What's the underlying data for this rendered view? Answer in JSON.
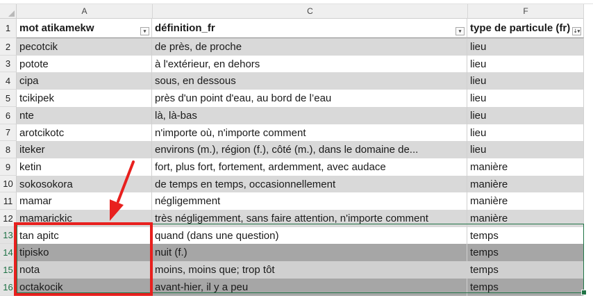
{
  "columns": [
    "A",
    "C",
    "F"
  ],
  "headers": {
    "A": "mot atikamekw",
    "C": "définition_fr",
    "F": "type de particule (fr)"
  },
  "rows": [
    {
      "n": "2",
      "a": "pecotcik",
      "c": "de près, de proche",
      "f": "lieu"
    },
    {
      "n": "3",
      "a": "potote",
      "c": "à l'extérieur, en dehors",
      "f": "lieu"
    },
    {
      "n": "4",
      "a": "cipa",
      "c": "sous, en dessous",
      "f": "lieu"
    },
    {
      "n": "5",
      "a": "tcikipek",
      "c": "près d'un point d'eau, au bord de l’eau",
      "f": "lieu"
    },
    {
      "n": "6",
      "a": "nte",
      "c": "là, là-bas",
      "f": "lieu"
    },
    {
      "n": "7",
      "a": "arotcikotc",
      "c": "n'importe où, n'importe comment",
      "f": "lieu"
    },
    {
      "n": "8",
      "a": "iteker",
      "c": "environs (m.), région (f.), côté (m.), dans le domaine de...",
      "f": "lieu"
    },
    {
      "n": "9",
      "a": "ketin",
      "c": "fort, plus fort, fortement, ardemment, avec audace",
      "f": "manière"
    },
    {
      "n": "10",
      "a": "sokosokora",
      "c": "de temps en temps, occasionnellement",
      "f": "manière"
    },
    {
      "n": "11",
      "a": "mamar",
      "c": "négligemment",
      "f": "manière"
    },
    {
      "n": "12",
      "a": "mamarickic",
      "c": "très négligemment, sans faire attention, n'importe comment",
      "f": "manière"
    },
    {
      "n": "13",
      "a": "tan apitc",
      "c": "quand (dans une question)",
      "f": "temps"
    },
    {
      "n": "14",
      "a": "tipisko",
      "c": "nuit (f.)",
      "f": "temps"
    },
    {
      "n": "15",
      "a": "nota",
      "c": "moins, moins que; trop tôt",
      "f": "temps"
    },
    {
      "n": "16",
      "a": "octakocik",
      "c": "avant-hier, il y a peu",
      "f": "temps"
    }
  ],
  "header_row_number": "1",
  "filter_icons": {
    "A": "dropdown-icon",
    "C": "dropdown-icon",
    "F": "sort-filter-icon"
  },
  "colors": {
    "band_light": "#d9d9d9",
    "band_dark": "#a6a6a6",
    "selection": "#217346",
    "annotation": "#e8201e"
  }
}
